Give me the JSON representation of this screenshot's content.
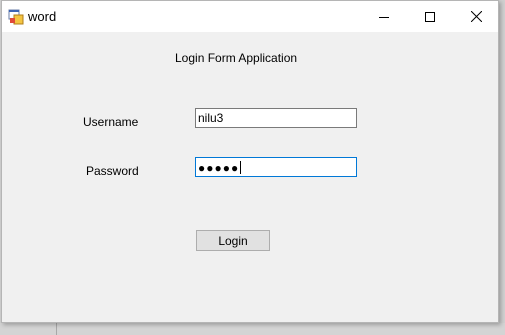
{
  "window": {
    "title": "word",
    "app_icon": "winforms-app-icon",
    "controls": {
      "minimize_icon": "minimize-icon",
      "maximize_icon": "maximize-icon",
      "close_icon": "close-icon"
    }
  },
  "form": {
    "heading": "Login Form Application",
    "username_label": "Username",
    "username_value": "nilu3",
    "password_label": "Password",
    "password_masked": "●●●●●",
    "login_button": "Login"
  },
  "colors": {
    "focus_border": "#0078d7",
    "window_bg": "#f0f0f0",
    "button_bg": "#e1e1e1"
  }
}
